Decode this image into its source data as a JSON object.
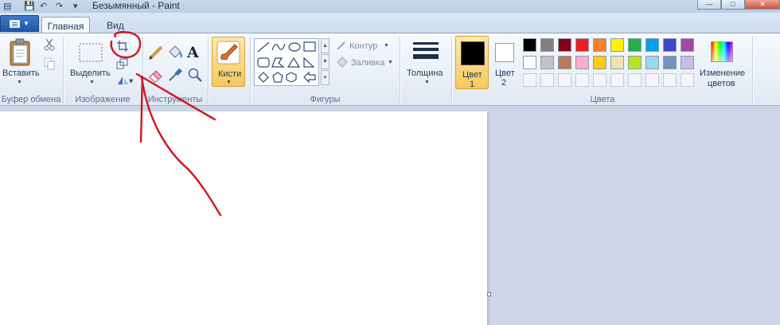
{
  "window": {
    "title": "Безымянный - Paint",
    "minimize_glyph": "—",
    "maximize_glyph": "□",
    "close_glyph": "✕"
  },
  "tabs": {
    "home": "Главная",
    "view": "Вид"
  },
  "clipboard": {
    "paste_label": "Вставить",
    "group_label": "Буфер обмена",
    "icons": [
      "clipboard-icon",
      "cut-icon",
      "copy-icon"
    ]
  },
  "image": {
    "select_label": "Выделить",
    "group_label": "Изображение",
    "icons": [
      "select-icon",
      "crop-icon",
      "resize-icon",
      "rotate-icon"
    ]
  },
  "tools": {
    "group_label": "Инструменты",
    "icons": [
      "pencil-icon",
      "fill-icon",
      "text-icon",
      "eraser-icon",
      "color-picker-icon",
      "magnifier-icon"
    ],
    "text_glyph": "A"
  },
  "brushes": {
    "label": "Кисти"
  },
  "shapes": {
    "group_label": "Фигуры",
    "outline_label": "Контур",
    "fill_label": "Заливка"
  },
  "size": {
    "label": "Толщина"
  },
  "colors": {
    "group_label": "Цвета",
    "color1_label": "Цвет",
    "color1_number": "1",
    "color2_label": "Цвет",
    "color2_number": "2",
    "edit_colors_line1": "Изменение",
    "edit_colors_line2": "цветов",
    "color1_value": "#000000",
    "color2_value": "#ffffff",
    "palette_row1": [
      "#000000",
      "#7f7f7f",
      "#880015",
      "#ed1c24",
      "#ff7f27",
      "#fff200",
      "#22b14c",
      "#00a2e8",
      "#3f48cc",
      "#a349a4"
    ],
    "palette_row2": [
      "#ffffff",
      "#c3c3c3",
      "#b97a57",
      "#ffaec9",
      "#ffc90e",
      "#efe4b0",
      "#b5e61d",
      "#99d9ea",
      "#7092be",
      "#c8bfe7"
    ],
    "palette_row3_empty_count": 10
  },
  "annotation": {
    "color": "#d4141c"
  }
}
